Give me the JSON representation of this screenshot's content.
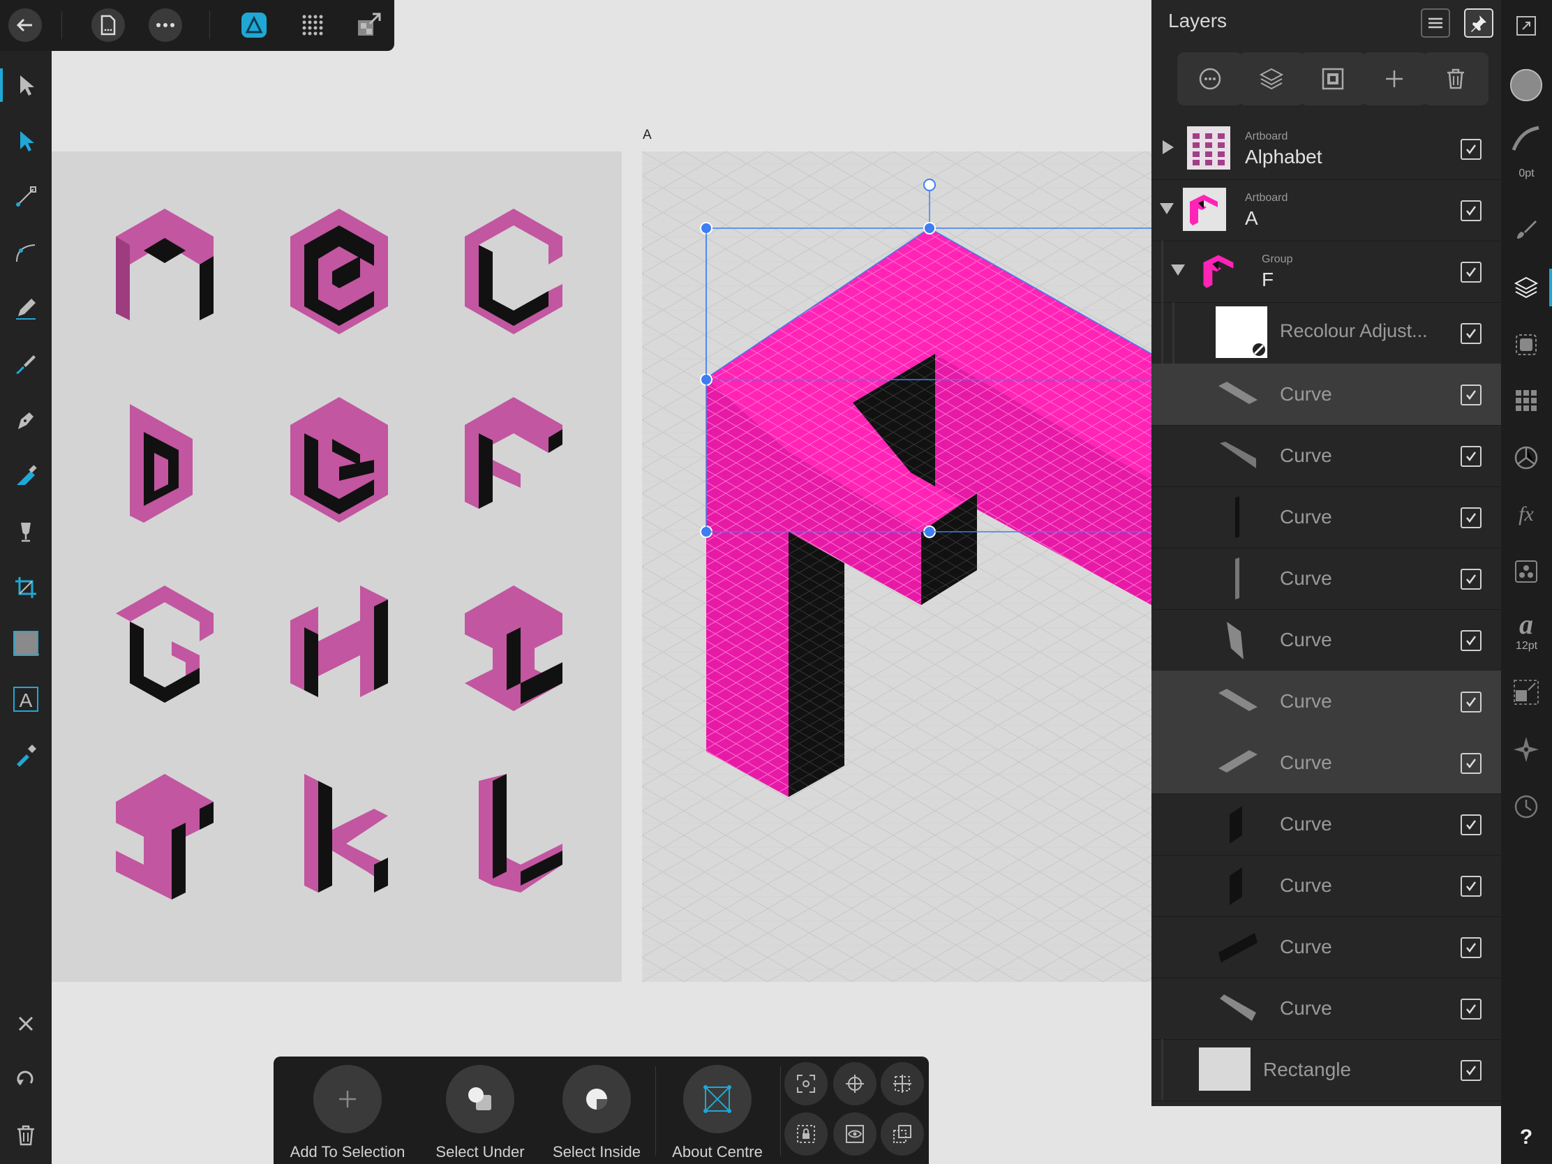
{
  "colors": {
    "magenta": "#ff24b6",
    "magenta_dark": "#d0178f",
    "letter_pink": "#c256a0",
    "letter_pink_dark": "#9d3d80",
    "selection_blue": "#3d7ef0",
    "accent_cyan": "#1fa8d6",
    "panel_bg": "#262626"
  },
  "canvas": {
    "artboard_a_label": "A",
    "alphabet_letters": [
      "A",
      "B",
      "C",
      "D",
      "E",
      "F",
      "G",
      "H",
      "I",
      "J",
      "K",
      "L"
    ]
  },
  "top_toolbar": {
    "icons": [
      "back-arrow-icon",
      "document-icon",
      "more-icon",
      "affinity-designer-persona-icon",
      "pixel-persona-icon",
      "export-persona-icon"
    ]
  },
  "layers_panel": {
    "title": "Layers",
    "rows": [
      {
        "type_label": "Artboard",
        "name": "Alphabet",
        "checked": true,
        "expanded": false
      },
      {
        "type_label": "Artboard",
        "name": "A",
        "checked": true,
        "expanded": true
      },
      {
        "type_label": "Group",
        "name": "F",
        "checked": true,
        "expanded": true
      },
      {
        "name": "Recolour Adjust...",
        "checked": true
      },
      {
        "name": "Curve",
        "checked": true,
        "selected": true
      },
      {
        "name": "Curve",
        "checked": true
      },
      {
        "name": "Curve",
        "checked": true
      },
      {
        "name": "Curve",
        "checked": true
      },
      {
        "name": "Curve",
        "checked": true
      },
      {
        "name": "Curve",
        "checked": true,
        "selected": true
      },
      {
        "name": "Curve",
        "checked": true,
        "selected": true
      },
      {
        "name": "Curve",
        "checked": true
      },
      {
        "name": "Curve",
        "checked": true
      },
      {
        "name": "Curve",
        "checked": true
      },
      {
        "name": "Curve",
        "checked": true
      },
      {
        "name": "Rectangle",
        "checked": true
      }
    ]
  },
  "studio": {
    "stroke_width": "0pt",
    "font_size": "12pt",
    "fx_label": "fx",
    "text_style_glyph": "a",
    "help_label": "?"
  },
  "context_toolbar": {
    "add_to_selection": "Add To Selection",
    "select_under": "Select Under",
    "select_inside": "Select Inside",
    "about_centre": "About Centre"
  }
}
